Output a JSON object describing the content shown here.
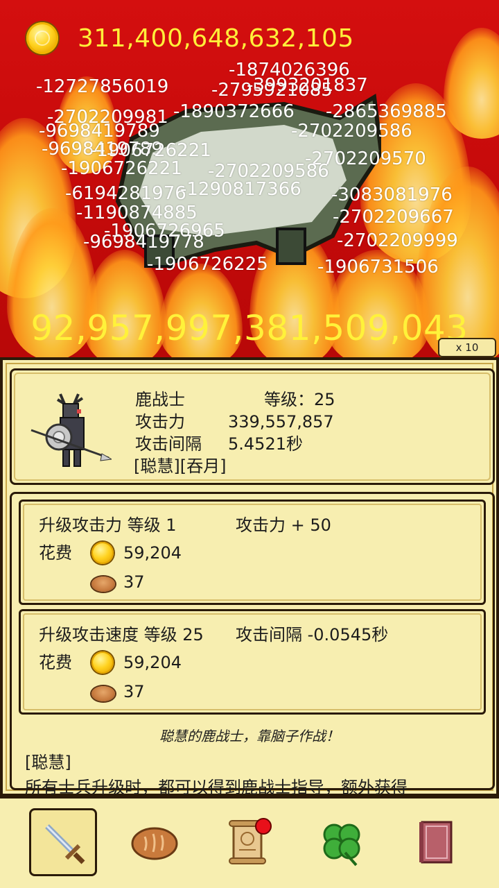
{
  "header": {
    "gold": "311,400,648,632,105",
    "gold_icon": "gold-coin-icon"
  },
  "battle": {
    "boss_total_damage": "92,957,997,381,509,043",
    "multiplier": "x 10",
    "damage_numbers": [
      "-1874026396",
      "-12727856019",
      "-2795921085",
      "-3993201837",
      "-2702209981",
      "-1890372666",
      "-2865369885",
      "-9698419789",
      "-2702209586",
      "-9698419789",
      "-2702209570",
      "-1906726221",
      "-2702209586",
      "-6194281976",
      "-1290817366",
      "-3083081976",
      "-2702209667",
      "-1190874885",
      "-1906726965",
      "-9698419778",
      "-2702209999",
      "-1906726225",
      "-1906731506",
      "-1906726221"
    ]
  },
  "unit": {
    "name": "鹿战士",
    "level_label": "等级：25",
    "attack_label": "攻击力",
    "attack_value": "339,557,857",
    "interval_label": "攻击间隔",
    "interval_value": "5.4521秒",
    "traits": "[聪慧][吞月]"
  },
  "upgrades": [
    {
      "title": "升级攻击力 等级 1",
      "effect": "攻击力 + 50",
      "cost_label": "花费",
      "gold_cost": "59,204",
      "bread_cost": "37"
    },
    {
      "title": "升级攻击速度 等级 25",
      "effect": "攻击间隔 -0.0545秒",
      "cost_label": "花费",
      "gold_cost": "59,204",
      "bread_cost": "37"
    }
  ],
  "description": {
    "flavor": "聪慧的鹿战士，靠脑子作战！",
    "trait_title": "[聪慧]",
    "trait_text": "所有士兵升级时，都可以得到鹿战士指导，额外获得"
  },
  "nav": [
    {
      "id": "soldiers",
      "icon": "sword-icon",
      "active": true
    },
    {
      "id": "food",
      "icon": "bread-icon",
      "active": false
    },
    {
      "id": "quests",
      "icon": "scroll-icon",
      "active": false,
      "badge": true
    },
    {
      "id": "luck",
      "icon": "clover-icon",
      "active": false
    },
    {
      "id": "book",
      "icon": "book-icon",
      "active": false
    }
  ],
  "colors": {
    "gold_text": "#ffef3a",
    "panel_bg": "#f7eeb0",
    "background": "#c50a0a",
    "badge": "#e8101a"
  }
}
